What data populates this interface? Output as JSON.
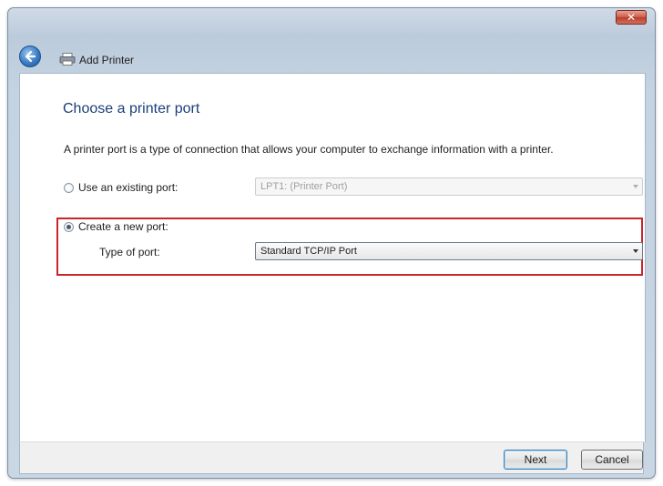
{
  "window": {
    "close_label": "✕",
    "title": "Add Printer"
  },
  "page": {
    "heading": "Choose a printer port",
    "description": "A printer port is a type of connection that allows your computer to exchange information with a printer."
  },
  "options": {
    "existing_port_label": "Use an existing port:",
    "existing_port_value": "LPT1: (Printer Port)",
    "existing_port_selected": false,
    "new_port_label": "Create a new port:",
    "new_port_selected": true,
    "type_of_port_label": "Type of port:",
    "type_of_port_value": "Standard TCP/IP Port"
  },
  "buttons": {
    "next": "Next",
    "cancel": "Cancel"
  },
  "colors": {
    "highlight_border": "#c8262a",
    "heading": "#1a3f7a"
  }
}
